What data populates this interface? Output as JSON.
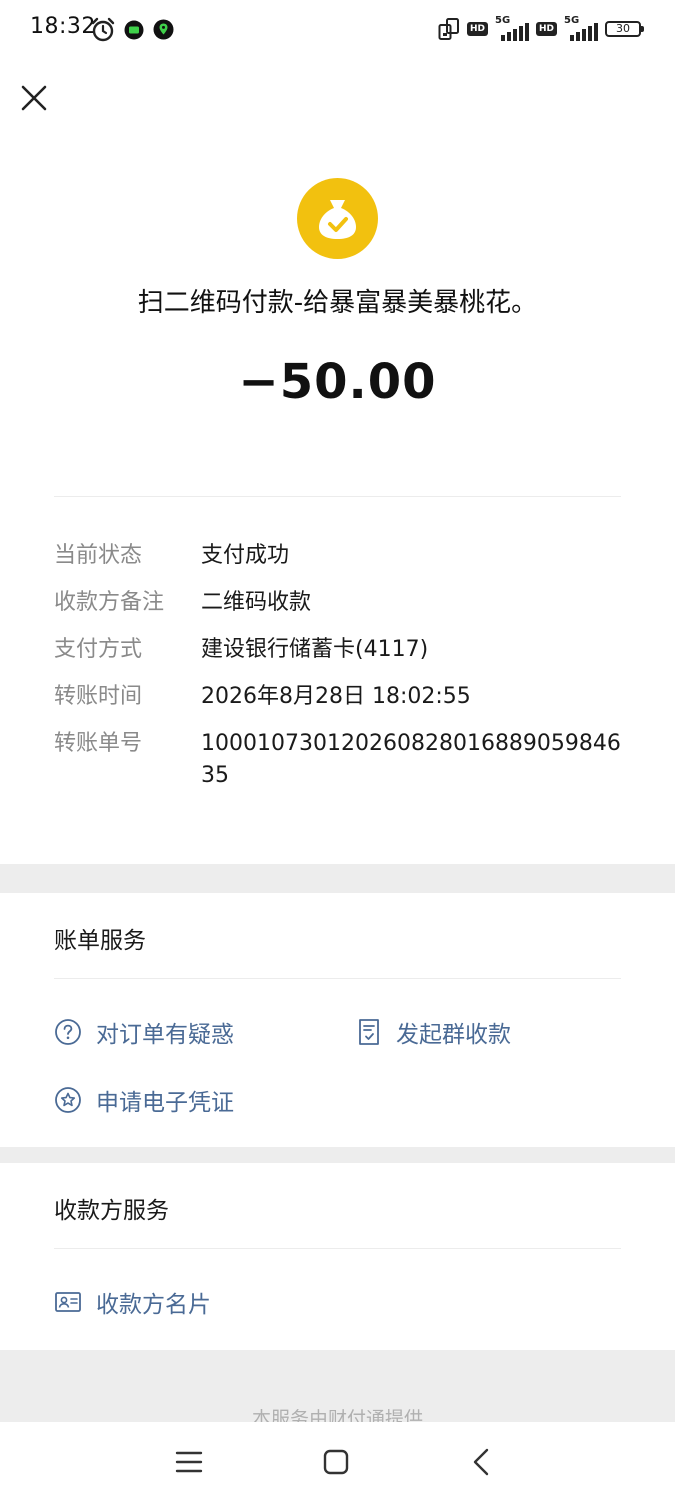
{
  "status_bar": {
    "time": "18:32",
    "network_1": "5G",
    "network_2": "5G",
    "hd_1": "HD",
    "hd_2": "HD",
    "battery": "30",
    "icons": [
      "alarm-icon",
      "chat-notification-icon",
      "location-notification-icon",
      "screen-rotate-icon",
      "signal-icon",
      "battery-icon"
    ]
  },
  "header": {
    "close_icon": "close-icon",
    "merchant_icon": "money-bag-check-icon"
  },
  "payment": {
    "title": "扫二维码付款-给暴富暴美暴桃花。",
    "amount": "−50.00"
  },
  "details": [
    {
      "label": "当前状态",
      "value": "支付成功"
    },
    {
      "label": "收款方备注",
      "value": "二维码收款"
    },
    {
      "label": "支付方式",
      "value": "建设银行储蓄卡(4117)"
    },
    {
      "label": "转账时间",
      "value": "2026年8月28日 18:02:55"
    },
    {
      "label": "转账单号",
      "value": "100010730120260828016889059846​35"
    }
  ],
  "bill_service": {
    "title": "账单服务",
    "actions": [
      {
        "label": "对订单有疑惑",
        "icon": "question-circle-icon"
      },
      {
        "label": "发起群收款",
        "icon": "document-check-icon"
      },
      {
        "label": "申请电子凭证",
        "icon": "star-circle-icon"
      }
    ]
  },
  "payee_service": {
    "title": "收款方服务",
    "actions": [
      {
        "label": "收款方名片",
        "icon": "contact-card-icon"
      }
    ]
  },
  "footer": {
    "text": "本服务由财付通提供"
  },
  "nav_bar": {
    "icons": [
      "menu-icon",
      "home-icon",
      "back-icon"
    ]
  },
  "colors": {
    "background": "#ededed",
    "card": "#ffffff",
    "label": "#8a8a8a",
    "link": "#4a6a95",
    "merchant_logo": "#f2c10f"
  }
}
